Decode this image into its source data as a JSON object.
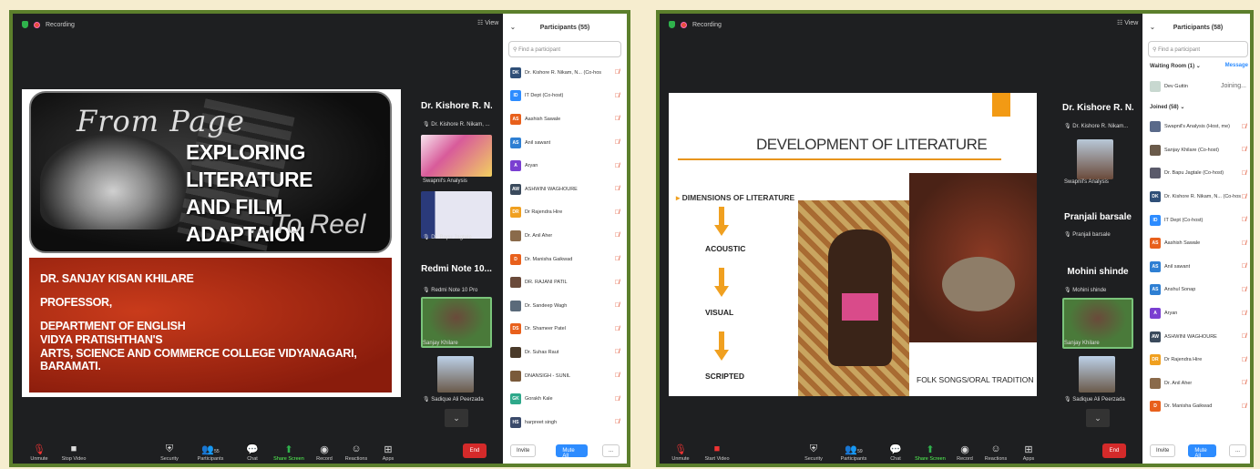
{
  "left": {
    "recording_label": "Recording",
    "view_label": "View",
    "slide": {
      "from_text": "From Page",
      "title_line1": "EXPLORING LITERATURE",
      "title_line2": "AND FILM ADAPTAION",
      "reel_text": "...To Reel",
      "lines": [
        "DR. SANJAY KISAN KHILARE",
        "PROFESSOR,",
        "DEPARTMENT OF ENGLISH",
        "VIDYA PRATISHTHAN'S",
        "ARTS, SCIENCE AND COMMERCE COLLEGE VIDYANAGARI, BARAMATI."
      ]
    },
    "tiles": [
      {
        "name": "Dr. Kishore R. N...",
        "sub": "Dr. Kishore R. Nikam, ..."
      },
      {
        "name": "",
        "sub": "Swapnil's Analysis"
      },
      {
        "name": "",
        "sub": "Dr. Bapu Jagtale"
      },
      {
        "name": "Redmi Note 10...",
        "sub": "Redmi Note 10 Pro"
      },
      {
        "name": "",
        "sub": "Sanjay Khilare"
      },
      {
        "name": "",
        "sub": "Sadique Ali Peerzada"
      }
    ],
    "sidebar": {
      "title": "Participants (55)",
      "search_placeholder": "Find a participant",
      "participants": [
        {
          "initials": "DK",
          "name": "Dr. Kishore R. Nikam, N... (Co-host)",
          "color": "#2f4f78"
        },
        {
          "initials": "ID",
          "name": "IT Dept (Co-host)",
          "color": "#2d8cff"
        },
        {
          "initials": "AS",
          "name": "Aashish Sawale",
          "color": "#e8601c"
        },
        {
          "initials": "AS",
          "name": "Anil sawant",
          "color": "#2e7fd3"
        },
        {
          "initials": "A",
          "name": "Aryan",
          "color": "#7a3fd1"
        },
        {
          "initials": "AW",
          "name": "ASHWINI WAGHOURE",
          "color": "#3a4a5c"
        },
        {
          "initials": "DR",
          "name": "Dr Rajendra Hire",
          "color": "#f0a020"
        },
        {
          "initials": "",
          "name": "Dr. Anil Aher",
          "color": "#8a6a4a"
        },
        {
          "initials": "D",
          "name": "Dr. Manisha Gaikwad",
          "color": "#e8601c"
        },
        {
          "initials": "",
          "name": "DR. RAJANI PATIL",
          "color": "#6a4a3a"
        },
        {
          "initials": "",
          "name": "Dr. Sandeep Wagh",
          "color": "#5a6a7a"
        },
        {
          "initials": "DS",
          "name": "Dr. Shameer Patel",
          "color": "#e8601c"
        },
        {
          "initials": "",
          "name": "Dr. Suhas Raut",
          "color": "#4a3a2a"
        },
        {
          "initials": "",
          "name": "DNANSIGH - SUNIL",
          "color": "#7a5a3a"
        },
        {
          "initials": "GK",
          "name": "Gorakh Kale",
          "color": "#2ea88a"
        },
        {
          "initials": "HS",
          "name": "harpreet singh",
          "color": "#3a4a6a"
        }
      ],
      "invite_label": "Invite",
      "mute_all_label": "Mute All",
      "more_label": "..."
    },
    "toolbar": {
      "unmute": "Unmute",
      "stop_video": "Stop Video",
      "security": "Security",
      "participants": "Participants",
      "participants_count": "55",
      "chat": "Chat",
      "share_screen": "Share Screen",
      "record": "Record",
      "reactions": "Reactions",
      "apps": "Apps",
      "end": "End"
    }
  },
  "right": {
    "recording_label": "Recording",
    "view_label": "View",
    "slide": {
      "title": "DEVELOPMENT OF LITERATURE",
      "dimensions": "DIMENSIONS OF LITERATURE",
      "acoustic": "ACOUSTIC",
      "visual": "VISUAL",
      "scripted": "SCRIPTED",
      "folk": "FOLK SONGS/ORAL TRADITION"
    },
    "tiles": [
      {
        "name": "Dr. Kishore R. N...",
        "sub": "Dr. Kishore R. Nikam..."
      },
      {
        "name": "",
        "sub": "Swapnil's Analysis"
      },
      {
        "name": "Pranjali barsale",
        "sub": "Pranjali barsale"
      },
      {
        "name": "Mohini shinde",
        "sub": "Mohini shinde"
      },
      {
        "name": "",
        "sub": "Sanjay Khilare"
      },
      {
        "name": "",
        "sub": "Sadique Ali Peerzada"
      }
    ],
    "sidebar": {
      "title": "Participants (58)",
      "search_placeholder": "Find a participant",
      "waiting_room": "Waiting Room (1)",
      "message_label": "Message",
      "waiting_name": "Dev Guttin",
      "waiting_status": "Joining...",
      "joined_label": "Joined (58)",
      "participants": [
        {
          "initials": "",
          "name": "Swapnil's Analysis (Host, me)",
          "color": "#5a6a8a"
        },
        {
          "initials": "",
          "name": "Sanjay Khilare (Co-host)",
          "color": "#6a5a4a"
        },
        {
          "initials": "",
          "name": "Dr. Bapu Jagtale (Co-host)",
          "color": "#5a5a6a"
        },
        {
          "initials": "DK",
          "name": "Dr. Kishore R. Nikam, N... (Co-host)",
          "color": "#2f4f78"
        },
        {
          "initials": "ID",
          "name": "IT Dept (Co-host)",
          "color": "#2d8cff"
        },
        {
          "initials": "AS",
          "name": "Aashish Sawale",
          "color": "#e8601c"
        },
        {
          "initials": "AS",
          "name": "Anil sawant",
          "color": "#2e7fd3"
        },
        {
          "initials": "AS",
          "name": "Anshul Sonap",
          "color": "#2e7fd3"
        },
        {
          "initials": "A",
          "name": "Aryan",
          "color": "#7a3fd1"
        },
        {
          "initials": "AW",
          "name": "ASHWINI WAGHOURE",
          "color": "#3a4a5c"
        },
        {
          "initials": "DR",
          "name": "Dr Rajendra Hire",
          "color": "#f0a020"
        },
        {
          "initials": "",
          "name": "Dr. Anil Aher",
          "color": "#8a6a4a"
        },
        {
          "initials": "D",
          "name": "Dr. Manisha Gaikwad",
          "color": "#e8601c"
        }
      ],
      "invite_label": "Invite",
      "mute_all_label": "Mute All",
      "more_label": "..."
    },
    "toolbar": {
      "unmute": "Unmute",
      "start_video": "Start Video",
      "security": "Security",
      "participants": "Participants",
      "participants_count": "59",
      "chat": "Chat",
      "share_screen": "Share Screen",
      "record": "Record",
      "reactions": "Reactions",
      "apps": "Apps",
      "end": "End"
    }
  }
}
